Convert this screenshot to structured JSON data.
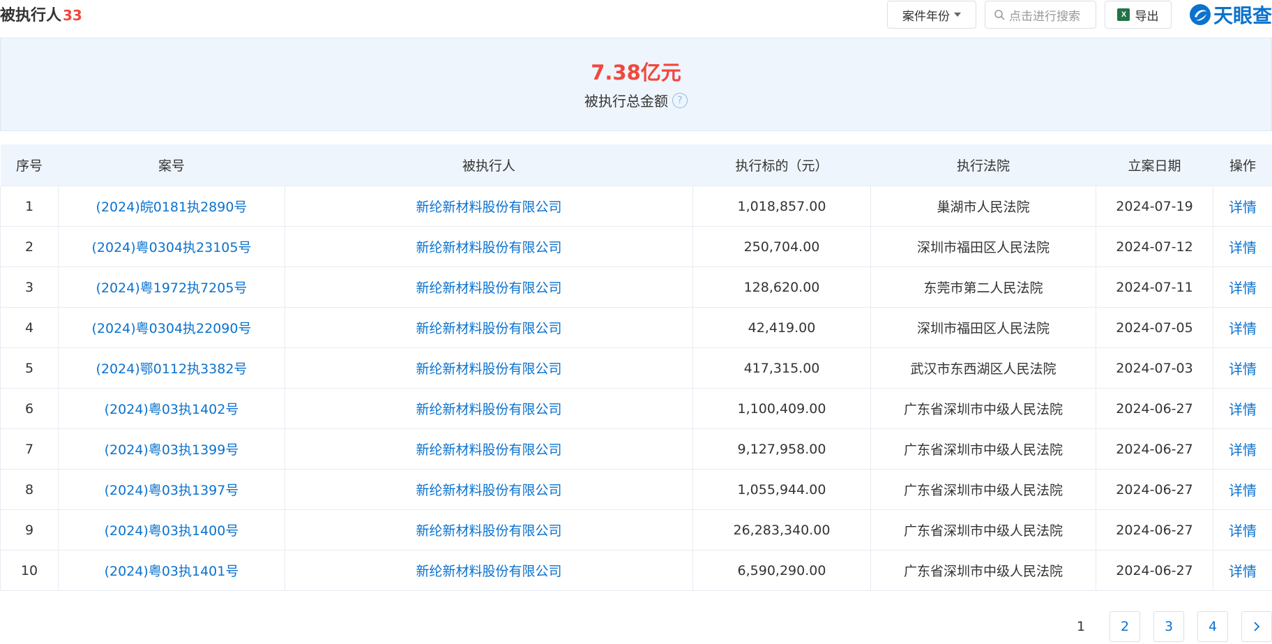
{
  "header": {
    "title": "被执行人",
    "count": "33",
    "year_filter": "案件年份",
    "search_placeholder": "点击进行搜索",
    "export_label": "导出",
    "logo_text": "天眼查"
  },
  "summary": {
    "amount": "7.38亿元",
    "label": "被执行总金额",
    "help_glyph": "?"
  },
  "table": {
    "columns": [
      "序号",
      "案号",
      "被执行人",
      "执行标的（元）",
      "执行法院",
      "立案日期",
      "操作"
    ],
    "rows": [
      {
        "idx": "1",
        "case": "(2024)皖0181执2890号",
        "party": "新纶新材料股份有限公司",
        "amount": "1,018,857.00",
        "court": "巢湖市人民法院",
        "date": "2024-07-19",
        "action": "详情"
      },
      {
        "idx": "2",
        "case": "(2024)粤0304执23105号",
        "party": "新纶新材料股份有限公司",
        "amount": "250,704.00",
        "court": "深圳市福田区人民法院",
        "date": "2024-07-12",
        "action": "详情"
      },
      {
        "idx": "3",
        "case": "(2024)粤1972执7205号",
        "party": "新纶新材料股份有限公司",
        "amount": "128,620.00",
        "court": "东莞市第二人民法院",
        "date": "2024-07-11",
        "action": "详情"
      },
      {
        "idx": "4",
        "case": "(2024)粤0304执22090号",
        "party": "新纶新材料股份有限公司",
        "amount": "42,419.00",
        "court": "深圳市福田区人民法院",
        "date": "2024-07-05",
        "action": "详情"
      },
      {
        "idx": "5",
        "case": "(2024)鄂0112执3382号",
        "party": "新纶新材料股份有限公司",
        "amount": "417,315.00",
        "court": "武汉市东西湖区人民法院",
        "date": "2024-07-03",
        "action": "详情"
      },
      {
        "idx": "6",
        "case": "(2024)粤03执1402号",
        "party": "新纶新材料股份有限公司",
        "amount": "1,100,409.00",
        "court": "广东省深圳市中级人民法院",
        "date": "2024-06-27",
        "action": "详情"
      },
      {
        "idx": "7",
        "case": "(2024)粤03执1399号",
        "party": "新纶新材料股份有限公司",
        "amount": "9,127,958.00",
        "court": "广东省深圳市中级人民法院",
        "date": "2024-06-27",
        "action": "详情"
      },
      {
        "idx": "8",
        "case": "(2024)粤03执1397号",
        "party": "新纶新材料股份有限公司",
        "amount": "1,055,944.00",
        "court": "广东省深圳市中级人民法院",
        "date": "2024-06-27",
        "action": "详情"
      },
      {
        "idx": "9",
        "case": "(2024)粤03执1400号",
        "party": "新纶新材料股份有限公司",
        "amount": "26,283,340.00",
        "court": "广东省深圳市中级人民法院",
        "date": "2024-06-27",
        "action": "详情"
      },
      {
        "idx": "10",
        "case": "(2024)粤03执1401号",
        "party": "新纶新材料股份有限公司",
        "amount": "6,590,290.00",
        "court": "广东省深圳市中级人民法院",
        "date": "2024-06-27",
        "action": "详情"
      }
    ]
  },
  "pagination": {
    "pages": [
      "1",
      "2",
      "3",
      "4"
    ],
    "current": "1",
    "next_icon": "chevron-right-icon"
  },
  "colors": {
    "accent": "#0b72ce",
    "highlight": "#f0483e",
    "summary_bg": "#eef5fc"
  }
}
